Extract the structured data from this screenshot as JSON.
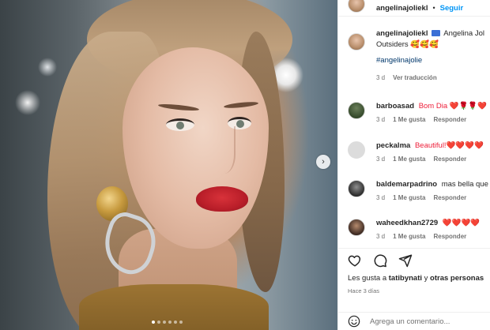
{
  "post": {
    "username": "angelinajoliekl",
    "follow_label": "Seguir",
    "separator": "•",
    "carousel": {
      "total_slides": 6,
      "active_slide": 1
    }
  },
  "caption": {
    "username": "angelinajoliekl",
    "text_before": "Angelina Jol",
    "text_line2": "Outsiders 🥰🥰🥰",
    "hashtag": "#angelinajolie",
    "age": "3 d",
    "translate": "Ver traducción"
  },
  "comments": [
    {
      "username": "barboasad",
      "text": "Bom Dia ❤️🌹🌹❤️",
      "age": "3 d",
      "likes": "1 Me gusta",
      "reply": "Responder"
    },
    {
      "username": "peckalma",
      "text": "Beautiful!❤️❤️❤️❤️",
      "age": "3 d",
      "likes": "1 Me gusta",
      "reply": "Responder"
    },
    {
      "username": "baldemarpadrino",
      "text": "mas bella que",
      "age": "3 d",
      "likes": "1 Me gusta",
      "reply": "Responder"
    },
    {
      "username": "waheedkhan2729",
      "text": "❤️❤️❤️❤️",
      "age": "3 d",
      "likes": "1 Me gusta",
      "reply": "Responder"
    }
  ],
  "likes": {
    "prefix": "Les gusta a ",
    "user": "tatibynati",
    "middle": " y ",
    "others": "otras personas"
  },
  "time_ago": "Hace 3 días",
  "composer": {
    "placeholder": "Agrega un comentario..."
  },
  "colors": {
    "accent": "#0095f6",
    "heart": "#ed1e39"
  }
}
